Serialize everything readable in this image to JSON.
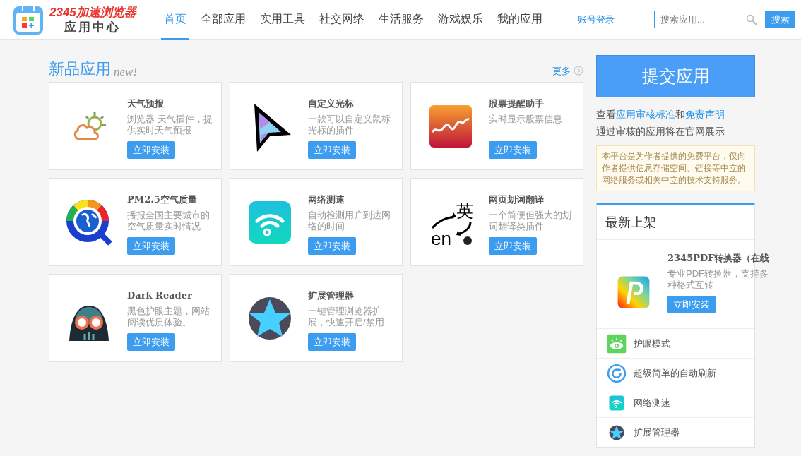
{
  "header": {
    "logo_brand": "2345加速浏览器",
    "logo_sub": "应用中心",
    "nav": [
      {
        "label": "首页",
        "selected": true
      },
      {
        "label": "全部应用",
        "selected": false
      },
      {
        "label": "实用工具",
        "selected": false
      },
      {
        "label": "社交网络",
        "selected": false
      },
      {
        "label": "生活服务",
        "selected": false
      },
      {
        "label": "游戏娱乐",
        "selected": false
      },
      {
        "label": "我的应用",
        "selected": false
      }
    ],
    "login": "账号登录",
    "search": {
      "placeholder": "搜索应用...",
      "button": "搜索"
    }
  },
  "new_apps": {
    "title": "新品应用",
    "title_tag": "new!",
    "more": "更多",
    "apps": [
      {
        "kind": "weather",
        "name": "天气预报",
        "desc": "浏览器 天气插件，提供实时天气预报",
        "button": "立即安装"
      },
      {
        "kind": "cursor",
        "name": "自定义光标",
        "desc": "一款可以自定义鼠标光标的插件",
        "button": "立即安装"
      },
      {
        "kind": "stock",
        "name": "股票提醒助手",
        "desc": "实时显示股票信息",
        "button": "立即安装"
      },
      {
        "kind": "air",
        "name": "PM2.5空气质量",
        "desc": "播报全国主要城市的空气质量实时情况",
        "button": "立即安装"
      },
      {
        "kind": "wifi",
        "name": "网络测速",
        "desc": "自动检测用户到达网络的时间",
        "button": "立即安装"
      },
      {
        "kind": "translate",
        "icon_texts": [
          "英",
          "en"
        ],
        "name": "网页划词翻译",
        "desc": "一个简便但强大的划词翻译类插件",
        "button": "立即安装"
      },
      {
        "kind": "darkreader",
        "name": "Dark Reader",
        "desc": "黑色护眼主题，网站阅读优质体验。",
        "button": "立即安装"
      },
      {
        "kind": "star",
        "name": "扩展管理器",
        "desc": "一键管理浏览器扩展，快速开启/禁用",
        "button": "立即安装"
      }
    ]
  },
  "sidebar": {
    "submit": "提交应用",
    "notice_prefix": "查看",
    "notice_link1": "应用审核标准",
    "notice_and": "和",
    "notice_link2": "免责声明",
    "notice_line2": "通过审核的应用将在官网展示",
    "disclaimer": "本平台是为作者提供的免费平台，仅向作者提供信息存储空间、链接等中立的网络服务或相关中立的技术支持服务。",
    "latest": {
      "title": "最新上架",
      "featured": {
        "kind": "pdf",
        "name": "2345PDF转换器（在线",
        "desc": "专业PDF转换器，支持多种格式互转",
        "button": "立即安装"
      },
      "items": [
        {
          "kind": "eye",
          "name": "护眼模式"
        },
        {
          "kind": "refresh",
          "name": "超级简单的自动刷新"
        },
        {
          "kind": "wifi",
          "name": "网络测速"
        },
        {
          "kind": "star",
          "name": "扩展管理器"
        }
      ]
    }
  }
}
